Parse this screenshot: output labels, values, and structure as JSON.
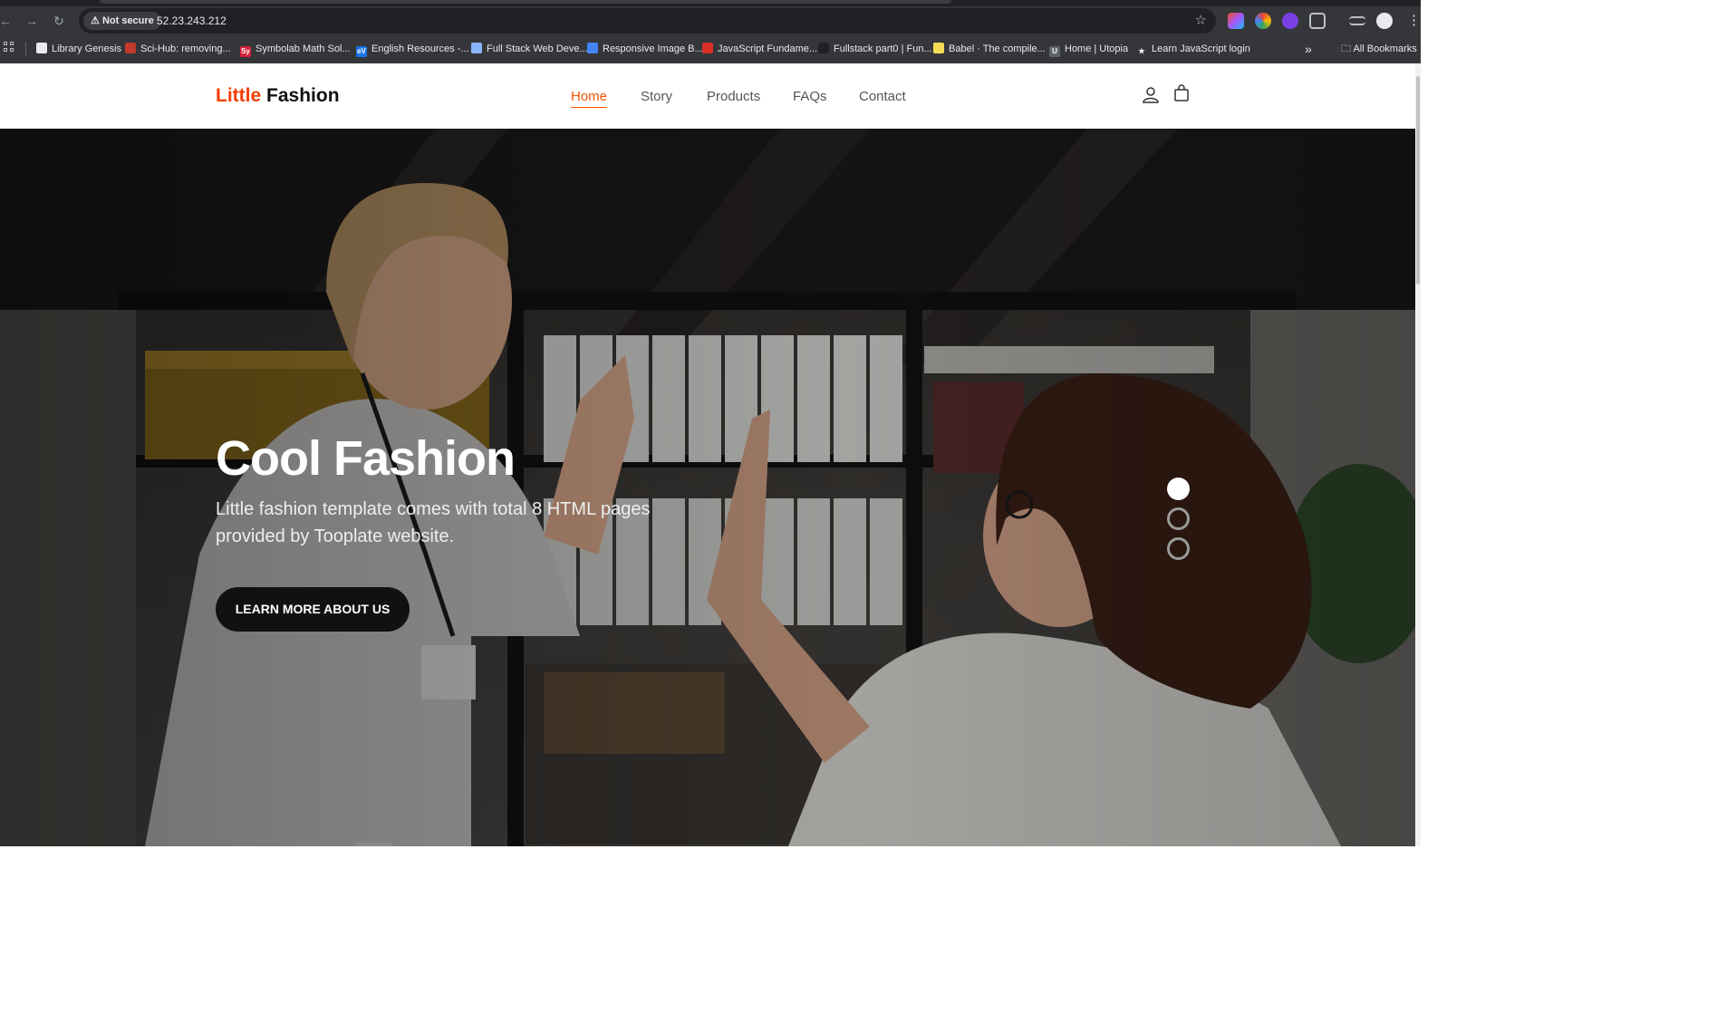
{
  "browser": {
    "security_chip": "Not secure",
    "url": "52.23.243.212",
    "bookmarks": [
      {
        "label": "Library Genesis",
        "fav_color": "#e8eaed",
        "fav_text": ""
      },
      {
        "label": "Sci-Hub: removing...",
        "fav_color": "#c0392b",
        "fav_text": ""
      },
      {
        "label": "Symbolab Math Sol...",
        "fav_color": "#d6213b",
        "fav_text": "Sy"
      },
      {
        "label": "English Resources -...",
        "fav_color": "#1a73e8",
        "fav_text": "eV"
      },
      {
        "label": "Full Stack Web Deve...",
        "fav_color": "#8ab4f8",
        "fav_text": ""
      },
      {
        "label": "Responsive Image B...",
        "fav_color": "#4285f4",
        "fav_text": ""
      },
      {
        "label": "JavaScript Fundame...",
        "fav_color": "#d93025",
        "fav_text": ""
      },
      {
        "label": "Fullstack part0 | Fun...",
        "fav_color": "#202124",
        "fav_text": ""
      },
      {
        "label": "Babel · The compile...",
        "fav_color": "#f5da55",
        "fav_text": ""
      },
      {
        "label": "Home | Utopia",
        "fav_color": "#e8eaed",
        "fav_text": "U"
      },
      {
        "label": "Learn JavaScript login",
        "fav_color": "#e8eaed",
        "fav_text": "★"
      }
    ],
    "all_bookmarks": "All Bookmarks"
  },
  "site": {
    "logo_accent": "Little",
    "logo_rest": "Fashion",
    "nav": [
      "Home",
      "Story",
      "Products",
      "FAQs",
      "Contact"
    ],
    "active_nav": "Home",
    "accent_color": "#f65300"
  },
  "hero": {
    "title": "Cool Fashion",
    "text": "Little fashion template comes with total 8 HTML pages provided by Tooplate website.",
    "button": "LEARN MORE ABOUT US",
    "slides_total": 3,
    "active_slide": 1
  }
}
